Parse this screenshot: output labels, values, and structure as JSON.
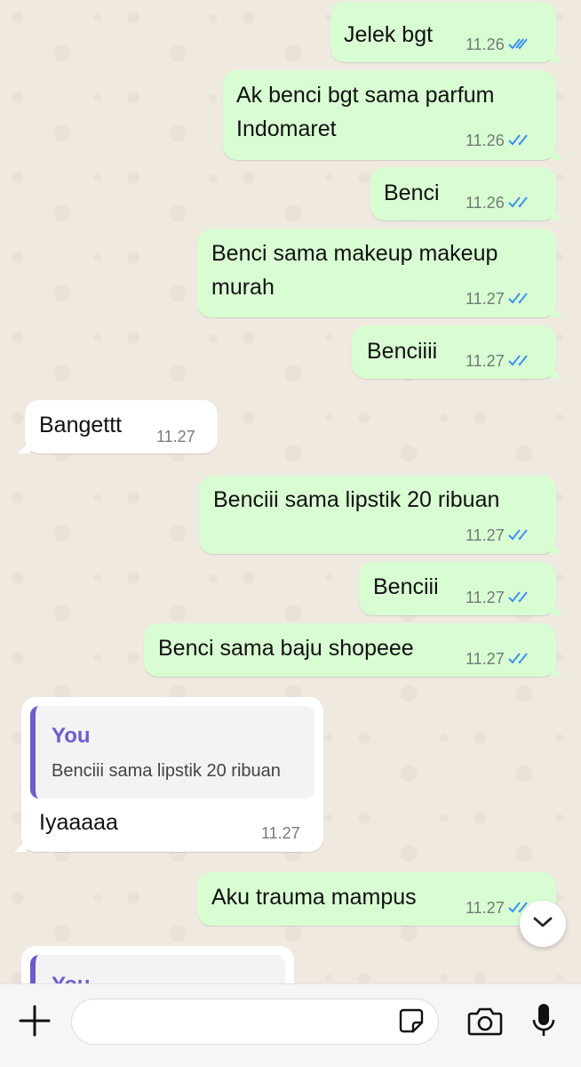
{
  "messages": [
    {
      "dir": "out",
      "text": "Jelek bgt",
      "time": "11.26",
      "ticks": "read"
    },
    {
      "dir": "out",
      "text": "Ak benci bgt sama parfum Indomaret",
      "time": "11.26",
      "ticks": "read"
    },
    {
      "dir": "out",
      "text": "Benci",
      "time": "11.26",
      "ticks": "read"
    },
    {
      "dir": "out",
      "text": "Benci sama makeup makeup murah",
      "time": "11.27",
      "ticks": "read"
    },
    {
      "dir": "out",
      "text": "Benciiii",
      "time": "11.27",
      "ticks": "read"
    },
    {
      "dir": "in",
      "text": "Bangettt",
      "time": "11.27"
    },
    {
      "dir": "out",
      "text": "Benciii sama lipstik 20 ribuan",
      "time": "11.27",
      "ticks": "read"
    },
    {
      "dir": "out",
      "text": "Benciii",
      "time": "11.27",
      "ticks": "read"
    },
    {
      "dir": "out",
      "text": "Benci sama baju shopeee",
      "time": "11.27",
      "ticks": "read"
    },
    {
      "dir": "in",
      "reply_author": "You",
      "reply_text": "Benciii sama lipstik 20 ribuan",
      "text": "Iyaaaaa",
      "time": "11.27"
    },
    {
      "dir": "out",
      "text": "Aku trauma mampus",
      "time": "11.27",
      "ticks": "read"
    },
    {
      "dir": "in",
      "reply_author": "You"
    }
  ],
  "colors": {
    "outgoing": "#d9fdd3",
    "incoming": "#ffffff",
    "read_ticks": "#3b8ff0",
    "reply_accent": "#6e5bd0"
  },
  "composer": {
    "icons": [
      "plus-icon",
      "sticker-icon",
      "camera-icon",
      "microphone-icon"
    ],
    "input_value": ""
  }
}
